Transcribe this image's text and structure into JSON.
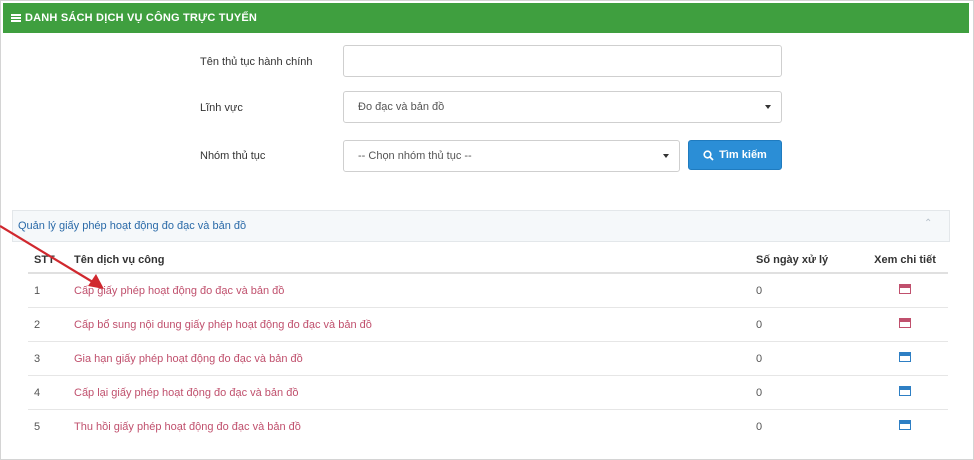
{
  "header": {
    "title": "DANH SÁCH DỊCH VỤ CÔNG TRỰC TUYẾN"
  },
  "form": {
    "procedure_name_label": "Tên thủ tục hành chính",
    "procedure_name_value": "",
    "field_label": "Lĩnh vực",
    "field_value": "Đo đạc và bản đồ",
    "group_label": "Nhóm thủ tục",
    "group_value": "-- Chọn nhóm thủ tục --",
    "search_button": "Tìm kiếm"
  },
  "panel": {
    "title": "Quản lý giấy phép hoạt động đo đạc và bản đồ"
  },
  "table": {
    "columns": [
      "STT",
      "Tên dịch vụ công",
      "Số ngày xử lý",
      "Xem chi tiết"
    ],
    "rows": [
      {
        "stt": "1",
        "name": "Cấp giấy phép hoạt động đo đạc và bản đồ",
        "days": "0",
        "icon": "calendar-icon",
        "icon_color": "#c0506d"
      },
      {
        "stt": "2",
        "name": "Cấp bổ sung nội dung giấy phép hoạt động đo đạc và bản đồ",
        "days": "0",
        "icon": "calendar-icon",
        "icon_color": "#c0506d"
      },
      {
        "stt": "3",
        "name": "Gia hạn giấy phép hoạt động đo đạc và bản đồ",
        "days": "0",
        "icon": "calendar-icon",
        "icon_color": "#2e7fc4"
      },
      {
        "stt": "4",
        "name": "Cấp lại giấy phép hoạt động đo đạc và bản đồ",
        "days": "0",
        "icon": "calendar-icon",
        "icon_color": "#2e7fc4"
      },
      {
        "stt": "5",
        "name": "Thu hồi giấy phép hoạt động đo đạc và bản đồ",
        "days": "0",
        "icon": "calendar-icon",
        "icon_color": "#2e7fc4"
      }
    ]
  },
  "colors": {
    "header_bg": "#3f9f3f",
    "button_bg": "#2b8ed6",
    "link": "#c0506d",
    "arrow": "#d0282e"
  }
}
